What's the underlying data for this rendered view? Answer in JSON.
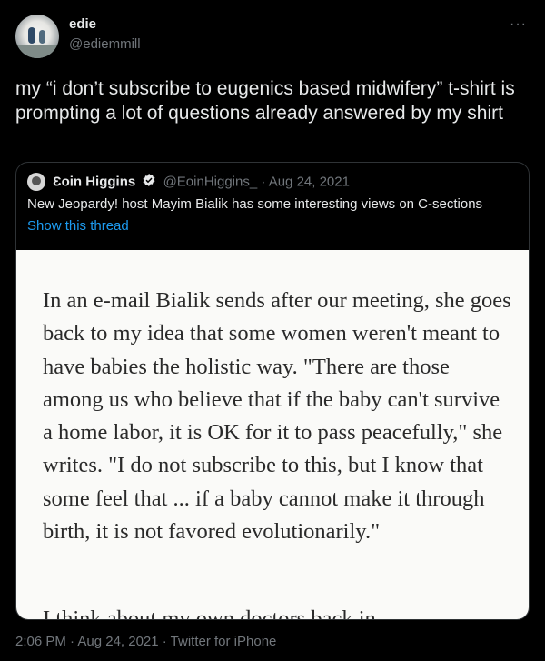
{
  "author": {
    "name": "edie",
    "handle": "@ediemmill"
  },
  "tweet": {
    "text": "my “i don’t subscribe to eugenics based midwifery” t-shirt is prompting a lot of questions already answered by my shirt"
  },
  "quoted": {
    "name": "Ɛoin Higgins",
    "handle": "@EoinHiggins_",
    "date": "· Aug 24, 2021",
    "text": "New Jeopardy! host Mayim Bialik has some interesting views on C-sections",
    "link": "Show this thread",
    "image_text": "In an e-mail Bialik sends after our meeting, she goes back to my idea that some women weren't meant to have babies the holistic way. \"There are those among us who believe that if the baby can't survive a home labor, it is OK for it to pass peacefully,\" she writes. \"I do not subscribe to this, but I know that some feel that ... if a baby cannot make it through birth, it is not favored evolutionarily.\"",
    "image_text_cut": "I think about my own doctors back in"
  },
  "meta": {
    "footer": "2:06 PM · Aug 24, 2021 · Twitter for iPhone"
  },
  "icons": {
    "more": "more-icon",
    "verified": "verified-badge-icon"
  },
  "colors": {
    "accent": "#1d9bf0",
    "muted": "#71767b"
  }
}
